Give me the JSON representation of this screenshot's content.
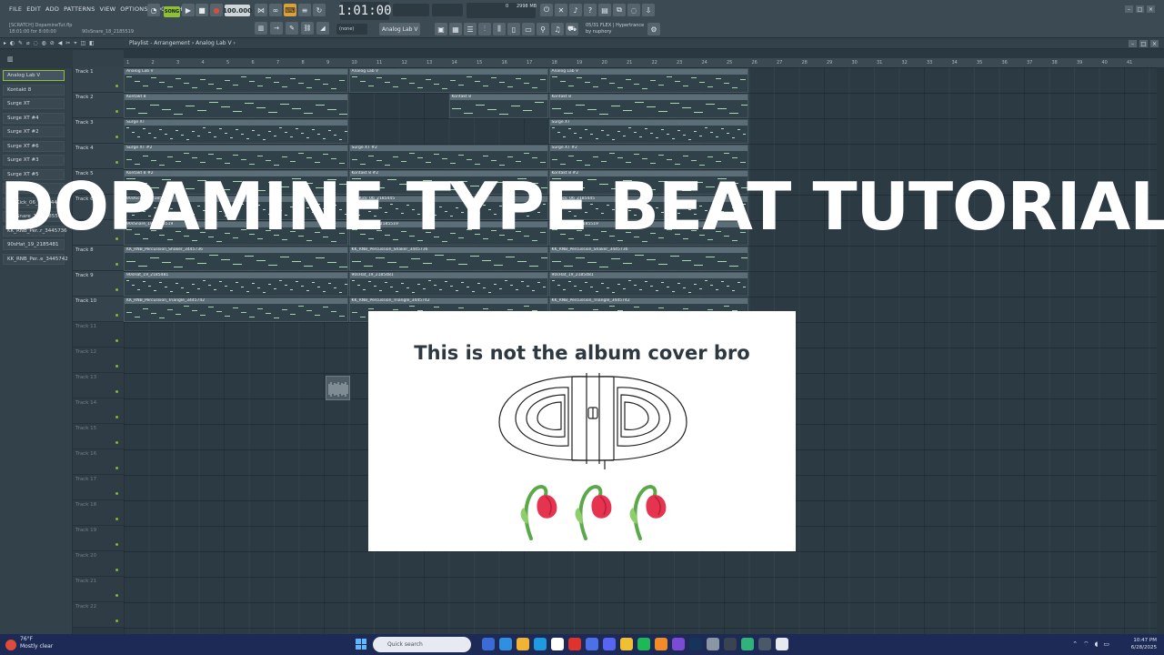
{
  "menu": [
    "FILE",
    "EDIT",
    "ADD",
    "PATTERNS",
    "VIEW",
    "OPTIONS",
    "TOOLS",
    "HELP"
  ],
  "song": {
    "file": "[SCRATCH] DopamineTut.flp",
    "position": "18:01:00 for 8:00:00",
    "hint": "90sSnare_18_2185519"
  },
  "transport": {
    "mode": "SONG",
    "tempo": "100.000",
    "time": "1:01:00"
  },
  "system": {
    "cpu": "0",
    "mem": "2998 MB",
    "voices": "0"
  },
  "toolbar": {
    "preset": "(none)",
    "plugin": "Analog Lab V"
  },
  "news": {
    "line1": "05/31 FLEX | Hypertrance",
    "line2": "by nuphory"
  },
  "playlist": {
    "breadcrumb": "Playlist - Arrangement › Analog Lab V ›"
  },
  "patterns": [
    "Analog Lab V",
    "Kontakt 8",
    "Surge XT",
    "Surge XT #4",
    "Surge XT #2",
    "Surge XT #6",
    "Surge XT #3",
    "Surge XT #5",
    "Kontakt 8 #2",
    "90sKick_06_2185445",
    "90sSnare_18_2185519",
    "KK_RNB_Per..r_3445736",
    "90sHat_19_2185481",
    "KK_RNB_Per..e_3445742"
  ],
  "tracks": [
    "Track 1",
    "Track 2",
    "Track 3",
    "Track 4",
    "Track 5",
    "Track 6",
    "Track 7",
    "Track 8",
    "Track 9",
    "Track 10",
    "Track 11",
    "Track 12",
    "Track 13",
    "Track 14",
    "Track 15",
    "Track 16",
    "Track 17",
    "Track 18",
    "Track 19",
    "Track 20",
    "Track 21",
    "Track 22"
  ],
  "ruler_ticks": [
    "1",
    "2",
    "3",
    "4",
    "5",
    "6",
    "7",
    "8",
    "9",
    "10",
    "11",
    "12",
    "13",
    "14",
    "15",
    "16",
    "17",
    "18",
    "19",
    "20",
    "21",
    "22",
    "23",
    "24",
    "25",
    "26",
    "27",
    "28",
    "29",
    "30",
    "31",
    "32",
    "33",
    "34",
    "35",
    "36",
    "37",
    "38",
    "39",
    "40",
    "41"
  ],
  "clips": [
    {
      "track": 0,
      "label": "Analog Lab V",
      "segments": [
        [
          0,
          9
        ],
        [
          9,
          17
        ],
        [
          17,
          25
        ]
      ]
    },
    {
      "track": 1,
      "label": "Kontakt 8",
      "segments": [
        [
          0,
          9
        ],
        [
          13,
          17
        ],
        [
          17,
          25
        ]
      ]
    },
    {
      "track": 2,
      "label": "Surge XT",
      "segments": [
        [
          0,
          9
        ],
        [
          17,
          25
        ]
      ]
    },
    {
      "track": 3,
      "label": "Surge XT #2",
      "segments": [
        [
          0,
          9
        ],
        [
          9,
          17
        ],
        [
          17,
          25
        ]
      ]
    },
    {
      "track": 4,
      "label": "Kontakt 8 #2",
      "segments": [
        [
          0,
          9
        ],
        [
          9,
          17
        ],
        [
          17,
          25
        ]
      ]
    },
    {
      "track": 5,
      "label": "90sKick_06_2185445",
      "segments": [
        [
          0,
          9
        ],
        [
          9,
          17
        ],
        [
          17,
          25
        ]
      ]
    },
    {
      "track": 6,
      "label": "90sSnare_18_2185519",
      "segments": [
        [
          0,
          9
        ],
        [
          9,
          17
        ],
        [
          17,
          25
        ]
      ]
    },
    {
      "track": 7,
      "label": "KK_RNB_Percussion_Shaker_3445736",
      "segments": [
        [
          0,
          9
        ],
        [
          9,
          17
        ],
        [
          17,
          25
        ]
      ]
    },
    {
      "track": 8,
      "label": "90sHat_19_2185481",
      "segments": [
        [
          0,
          9
        ],
        [
          9,
          17
        ],
        [
          17,
          25
        ]
      ]
    },
    {
      "track": 9,
      "label": "KK_RNB_Percussion_Triangle_3445742",
      "segments": [
        [
          0,
          9
        ],
        [
          9,
          17
        ],
        [
          17,
          25
        ]
      ]
    }
  ],
  "overlay": {
    "title": "DOPAMINE TYPE BEAT TUTORIAL",
    "cover_text": "This is not the album cover bro"
  },
  "taskbar": {
    "weather_temp": "76°F",
    "weather_desc": "Mostly clear",
    "search_placeholder": "Quick search",
    "time": "10:47 PM",
    "date": "6/28/2025"
  },
  "colors": {
    "accent": "#8fbf3a",
    "grid": "#2c3a44",
    "taskbar": "#1c2a55",
    "flower": "#e6334f",
    "stem": "#5aa84a"
  }
}
